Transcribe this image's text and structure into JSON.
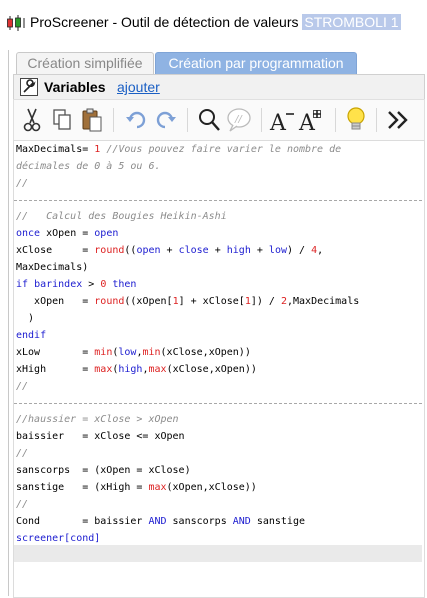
{
  "window": {
    "title": "ProScreener - Outil de détection de valeurs",
    "title_highlight": "STROMBOLI 1"
  },
  "tabs": [
    {
      "label": "Création simplifiée",
      "active": false
    },
    {
      "label": "Création par programmation",
      "active": true
    }
  ],
  "variables": {
    "label": "Variables",
    "add_link": "ajouter"
  },
  "toolbar": {
    "icons": [
      "cut-icon",
      "copy-icon",
      "paste-icon",
      "undo-icon",
      "redo-icon",
      "search-icon",
      "comment-icon",
      "decrease-font-icon",
      "increase-font-icon",
      "lightbulb-icon",
      "expand-icon"
    ]
  },
  "colors": {
    "keyword": "#1c1cd0",
    "function_number": "#dd2222",
    "comment": "#8c8c8c",
    "active_tab": "#8fb3e3",
    "link": "#1a5fc4"
  },
  "code": {
    "l1": {
      "a": "MaxDecimals= ",
      "b": "1",
      "c": " //Vous pouvez faire varier le nombre de"
    },
    "l2": "décimales de 0 à 5 ou 6.",
    "l3": "//",
    "l5": "//   Calcul des Bougies Heikin-Ashi",
    "l6": {
      "a": "once",
      "b": " xOpen = ",
      "c": "open"
    },
    "l7": {
      "a": "xClose     = ",
      "b": "round",
      "c": "((",
      "d": "open",
      "e": " + ",
      "f": "close",
      "g": " + ",
      "h": "high",
      "i": " + ",
      "j": "low",
      "k": ") / ",
      "l": "4",
      "m": ","
    },
    "l8": "MaxDecimals)",
    "l9": {
      "a": "if",
      "b": " ",
      "c": "barindex",
      "d": " > ",
      "e": "0",
      "f": " ",
      "g": "then"
    },
    "l10": {
      "a": "   xOpen   = ",
      "b": "round",
      "c": "((xOpen[",
      "d": "1",
      "e": "] + xClose[",
      "f": "1",
      "g": "]) / ",
      "h": "2",
      "i": ",MaxDecimals"
    },
    "l11": "  )",
    "l12": "endif",
    "l13": {
      "a": "xLow       = ",
      "b": "min",
      "c": "(",
      "d": "low",
      "e": ",",
      "f": "min",
      "g": "(xClose,xOpen))"
    },
    "l14": {
      "a": "xHigh      = ",
      "b": "max",
      "c": "(",
      "d": "high",
      "e": ",",
      "f": "max",
      "g": "(xClose,xOpen))"
    },
    "l15": "//",
    "l17": "//haussier = xClose > xOpen",
    "l18": "baissier   = xClose <= xOpen",
    "l19": "//",
    "l20": "sanscorps  = (xOpen = xClose)",
    "l21": {
      "a": "sanstige   = (xHigh = ",
      "b": "max",
      "c": "(xOpen,xClose))"
    },
    "l22": "//",
    "l23": {
      "a": "Cond       = baissier ",
      "b": "AND",
      "c": " sanscorps ",
      "d": "AND",
      "e": " sanstige"
    },
    "l24": "screener[cond]"
  }
}
